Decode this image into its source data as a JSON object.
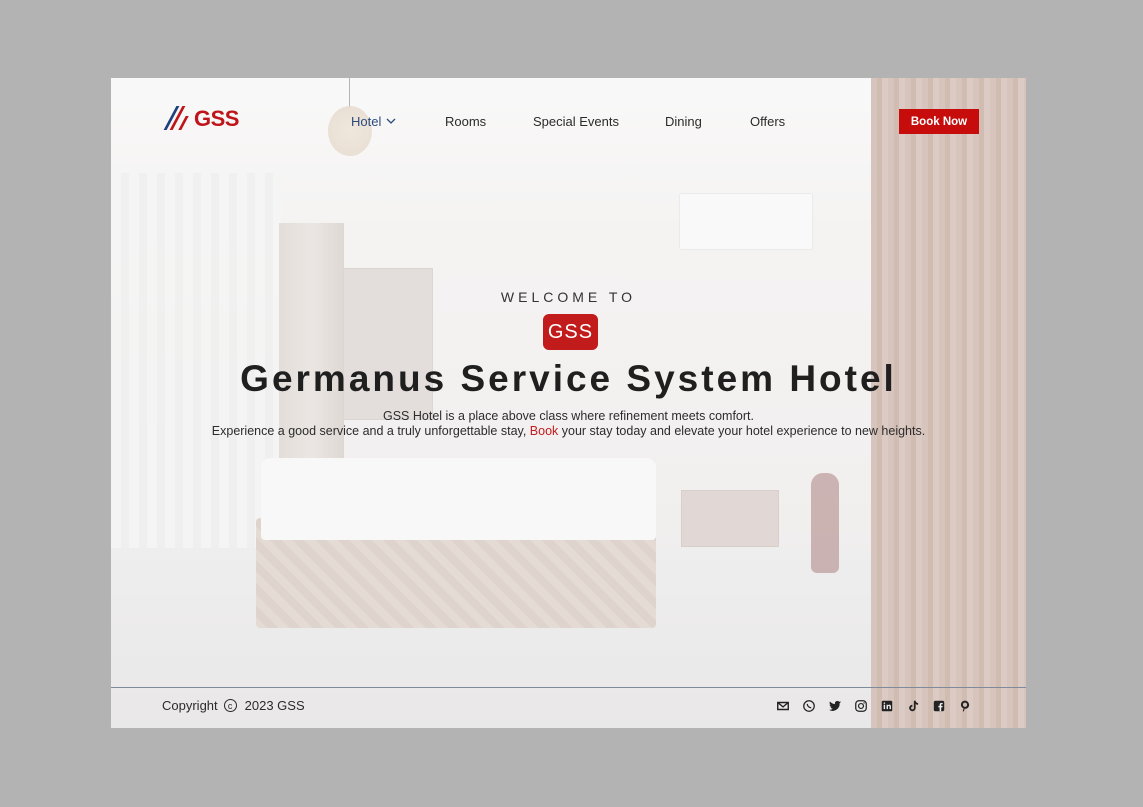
{
  "brand": {
    "logo_text": "GSS",
    "primary_color": "#c0141b",
    "accent_navy": "#1f3f7a"
  },
  "nav": {
    "items": [
      {
        "label": "Hotel",
        "active": true,
        "dropdown": true
      },
      {
        "label": "Rooms"
      },
      {
        "label": "Special Events"
      },
      {
        "label": "Dining"
      },
      {
        "label": "Offers"
      }
    ],
    "book_now": "Book Now"
  },
  "hero": {
    "welcome": "WELCOME TO",
    "badge": "GSS",
    "title": "Germanus Service System Hotel",
    "subtitle_line1": "GSS Hotel is a place above class where refinement meets comfort.",
    "subtitle_line2_before": "Experience a good service and a truly unforgettable stay, ",
    "subtitle_line2_link": "Book",
    "subtitle_line2_after": " your stay today and elevate your hotel experience to new heights."
  },
  "footer": {
    "copyright_label": "Copyright",
    "copyright_text": "2023 GSS",
    "social_icons": [
      "email-icon",
      "whatsapp-icon",
      "twitter-icon",
      "instagram-icon",
      "linkedin-icon",
      "tiktok-icon",
      "facebook-icon",
      "pinterest-icon"
    ]
  }
}
